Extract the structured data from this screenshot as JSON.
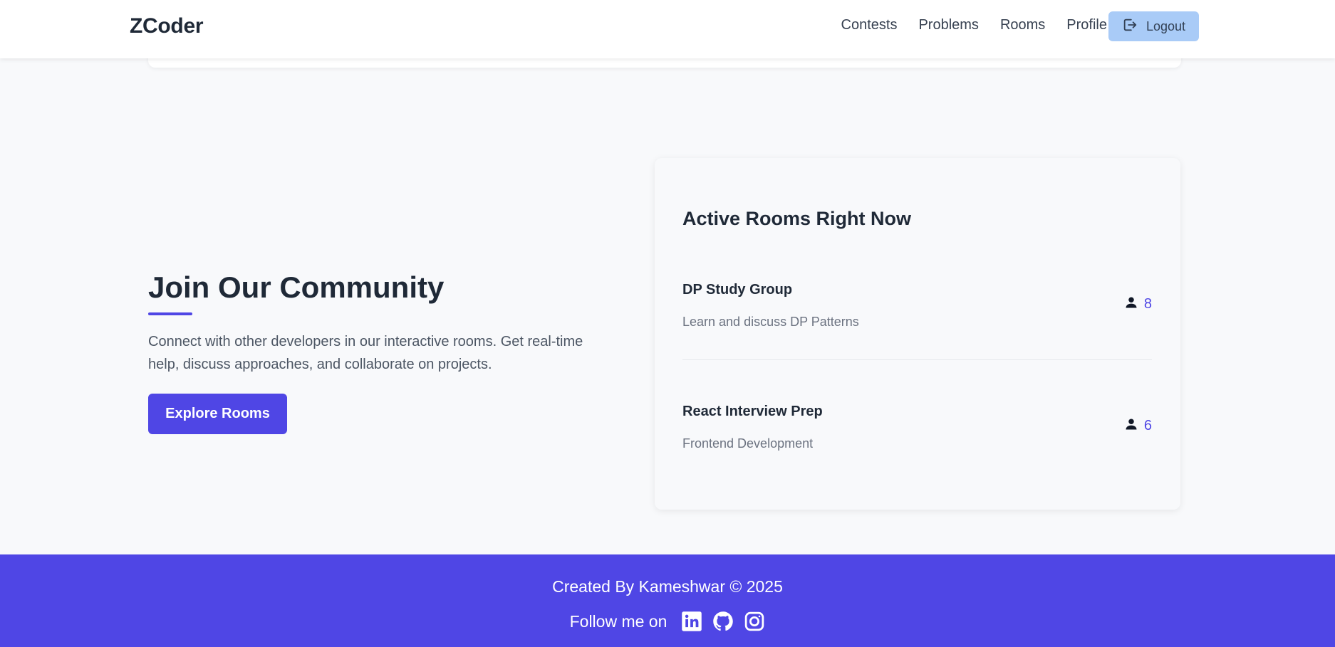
{
  "header": {
    "brand": "ZCoder",
    "nav": [
      "Contests",
      "Problems",
      "Rooms",
      "Profile"
    ],
    "logout_label": "Logout"
  },
  "community": {
    "title": "Join Our Community",
    "description": "Connect with other developers in our interactive rooms. Get real-time help, discuss approaches, and collaborate on projects.",
    "button_label": "Explore Rooms"
  },
  "active_rooms": {
    "title": "Active Rooms Right Now",
    "rooms": [
      {
        "name": "DP Study Group",
        "subtitle": "Learn and discuss DP Patterns",
        "count": "8"
      },
      {
        "name": "React Interview Prep",
        "subtitle": "Frontend Development",
        "count": "6"
      }
    ]
  },
  "footer": {
    "credit": "Created By Kameshwar © 2025",
    "follow_label": "Follow me on",
    "socials": [
      "linkedin-icon",
      "github-icon",
      "instagram-icon"
    ]
  },
  "colors": {
    "accent": "#4f46e5",
    "logout_bg": "#a9cbf7",
    "page_bg": "#f8f9fb"
  }
}
